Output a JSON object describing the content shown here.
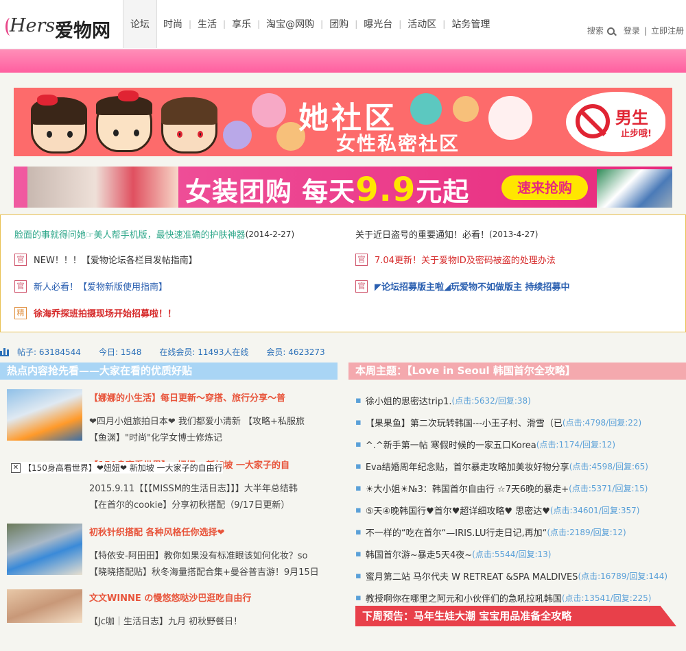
{
  "header": {
    "logo_script": "Hers",
    "logo_cn": "爱物网",
    "nav": [
      "论坛",
      "时尚",
      "生活",
      "享乐",
      "淘宝@网购",
      "团购",
      "曝光台",
      "活动区",
      "站务管理"
    ],
    "search_label": "搜索",
    "login": "登录",
    "register": "立即注册"
  },
  "banner1": {
    "title": "她社区",
    "subtitle": "女性私密社区",
    "badge_title": "男生",
    "badge_sub": "止步哦!"
  },
  "banner2": {
    "title_a": "女装团购 每天",
    "title_num": "9.9",
    "title_b": "元起",
    "button": "速来抢购"
  },
  "notices": {
    "left": [
      {
        "tag": "",
        "text": "脸面的事就得问她☞美人帮手机版，最快速准确的护肤神器",
        "date": "(2014-2-27)",
        "color": "#2ea78a"
      },
      {
        "tag": "官",
        "text": "NEW！！！【爱物论坛各栏目发帖指南】",
        "date": "",
        "color": "#333333"
      },
      {
        "tag": "官",
        "text": "新人必看！【爱物新版使用指南】",
        "date": "",
        "color": "#2a5fb0"
      },
      {
        "tag": "精",
        "text": "徐海乔探班拍摄现场开始招募啦！！",
        "date": "",
        "color": "#d62a2a"
      }
    ],
    "right": [
      {
        "tag": "",
        "text": "关于近日盗号的重要通知！必看！",
        "date": "(2013-4-27)",
        "color": "#333333"
      },
      {
        "tag": "官",
        "text": "7.04更新！关于爱物ID及密码被盗的处理办法",
        "date": "",
        "color": "#d62a2a"
      },
      {
        "tag": "官",
        "text": "◤论坛招募版主啦◢玩爱物不如做版主 持续招募中",
        "date": "",
        "color": "#2a5fb0"
      }
    ]
  },
  "stats": {
    "posts": "帖子: 63184544",
    "today": "今日: 1548",
    "online": "在线会员: 11493人在线",
    "members": "会员: 4623273"
  },
  "hot": {
    "heading": "热点内容抢先看——大家在看的优质好贴",
    "posts": [
      {
        "title": "【娜娜的小生活】每日更新～穿搭、旅行分享～普",
        "d1": "❤四月小姐旅拍日本❤ 我们都爱小清新 【攻略+私服旅",
        "d2": "【鱼渊】\"时尚\"化学女博士修炼记"
      },
      {
        "title": "【150身高看世界】❤妞妞❤ 新加坡 一大家子的自",
        "d1": "2015.9.11【【【MISSM的生活日志】】】大半年总结韩",
        "d2": "【在首尔的cookie】分享初秋搭配（9/17日更新）",
        "broken": "【150身高看世界】❤妞妞❤ 新加坡 一大家子的自由行"
      },
      {
        "title": "初秋针织搭配 各种风格任你选择❤",
        "d1": "【特依安-阿田田】教你如果没有标准眼该如何化妆？so",
        "d2": "【晓晓搭配贴】秋冬海量搭配合集+曼谷普吉游！9月15日"
      },
      {
        "title": "文文WINNE の慢悠悠哒沙巴逛吃自由行",
        "d1": "【Jc咖｜生活日志】九月 初秋野餐日！",
        "d2": ""
      }
    ]
  },
  "week": {
    "heading": "本周主题：【Love in Seoul 韩国首尔全攻略】",
    "items": [
      {
        "text": "徐小姐的思密达trip1.",
        "meta": "(点击:5632/回复:38)"
      },
      {
        "text": "【果果鱼】第二次玩转韩国---小王子村、滑雪（已",
        "meta": "(点击:4798/回复:22)"
      },
      {
        "text": "^.^新手第一帖 寒假时候的一家五口Korea",
        "meta": "(点击:1174/回复:12)"
      },
      {
        "text": "Eva结婚周年纪念贴，首尔暴走攻略加美妆好物分享",
        "meta": "(点击:4598/回复:65)"
      },
      {
        "text": "☀大小姐☀№3：韩国首尔自由行 ☆7天6晚的暴走+",
        "meta": "(点击:5371/回复:15)"
      },
      {
        "text": "⑤天④晚韩国行♥首尔♥超详细攻略♥ 思密达♥",
        "meta": "(点击:34601/回复:357)"
      },
      {
        "text": "不一样的“吃在首尔“—IRIS.LU行走日记,再加“",
        "meta": "(点击:2189/回复:12)"
      },
      {
        "text": "韩国首尔游~暴走5天4夜~",
        "meta": "(点击:5544/回复:13)"
      },
      {
        "text": "蜜月第二站 马尔代夫 W RETREAT &SPA MALDIVES",
        "meta": "(点击:16789/回复:144)"
      },
      {
        "text": "教授啊你在哪里之阿元和小伙伴们的急吼拉吼韩国",
        "meta": "(点击:13541/回复:225)"
      }
    ],
    "preview": "下周预告：马年生娃大潮 宝宝用品准备全攻略"
  }
}
